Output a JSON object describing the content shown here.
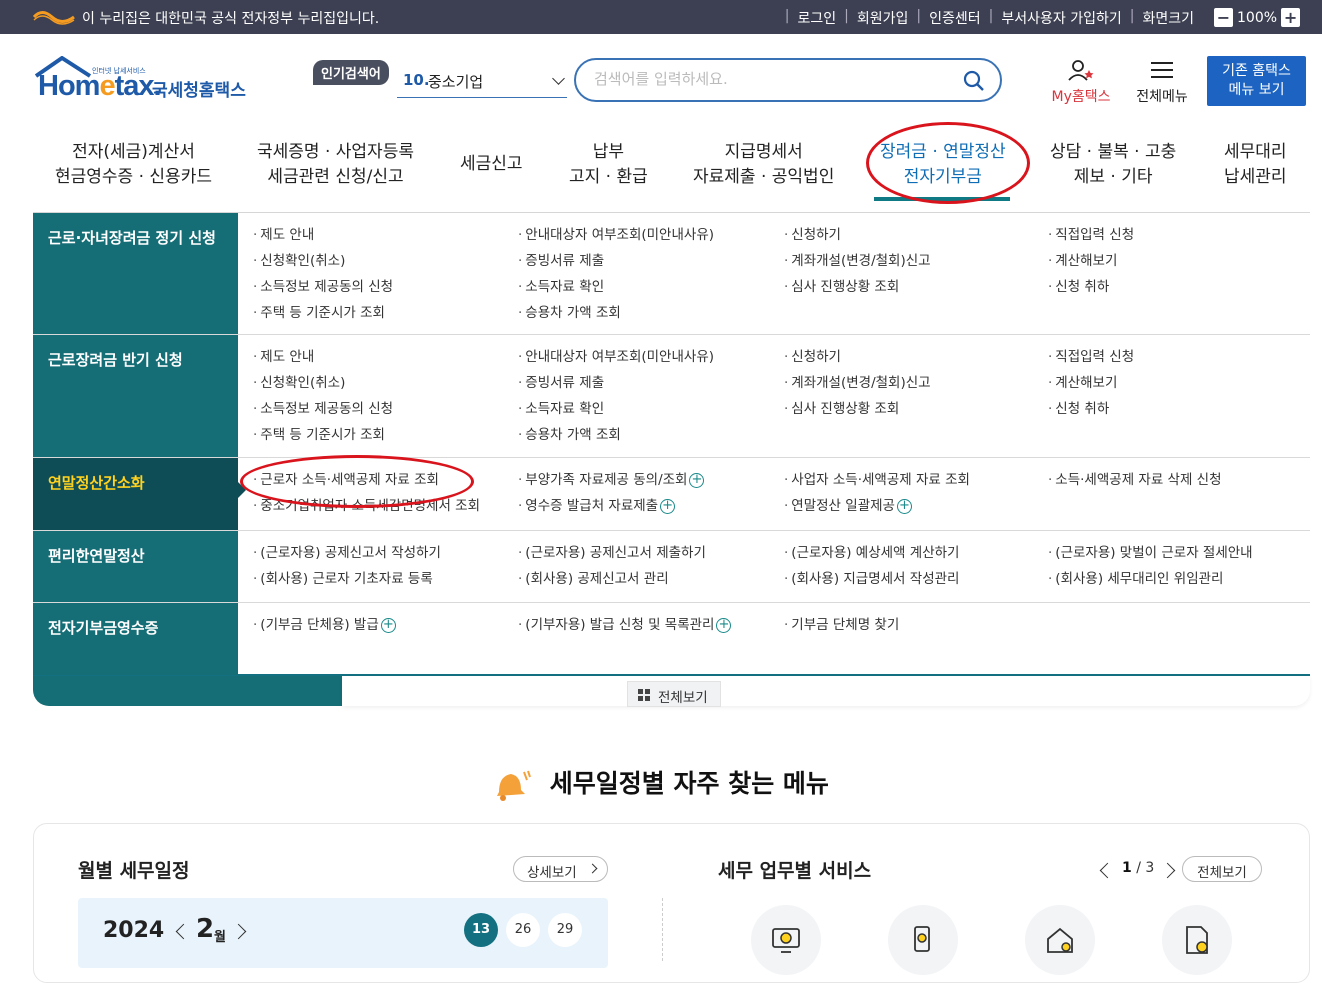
{
  "topbar": {
    "gov_notice": "이 누리집은 대한민국 공식 전자정부 누리집입니다.",
    "links": [
      "로그인",
      "회원가입",
      "인증센터",
      "부서사용자 가입하기",
      "화면크기"
    ],
    "zoom": "100%"
  },
  "header": {
    "logo_small": "인터넷 납세서비스",
    "logo_word_a": "Hom",
    "logo_word_b": "e",
    "logo_word_c": "tax.",
    "logo_kr": "국세청홈택스",
    "popular_badge": "인기검색어",
    "popular_num": "10.",
    "popular_word": "중소기업",
    "search_placeholder": "검색어를 입력하세요.",
    "my_hometax": "My홈택스",
    "all_menu": "전체메뉴",
    "old_menu_1": "기존 홈택스",
    "old_menu_2": "메뉴 보기"
  },
  "gnb": [
    {
      "l1": "전자(세금)계산서",
      "l2": "현금영수증 · 신용카드"
    },
    {
      "l1": "국세증명 · 사업자등록",
      "l2": "세금관련 신청/신고"
    },
    {
      "l1": "세금신고",
      "l2": ""
    },
    {
      "l1": "납부",
      "l2": "고지 · 환급"
    },
    {
      "l1": "지급명세서",
      "l2": "자료제출 · 공익법인"
    },
    {
      "l1": "장려금 · 연말정산",
      "l2": "전자기부금"
    },
    {
      "l1": "상담 · 불복 · 고충",
      "l2": "제보 · 기타"
    },
    {
      "l1": "세무대리",
      "l2": "납세관리"
    }
  ],
  "menu": [
    {
      "label": "근로·자녀장려금 정기 신청",
      "cols": [
        [
          "제도 안내",
          "신청확인(취소)",
          "소득정보 제공동의 신청",
          "주택 등 기준시가 조회"
        ],
        [
          "안내대상자 여부조회(미안내사유)",
          "증빙서류 제출",
          "소득자료 확인",
          "승용차 가액 조회"
        ],
        [
          "신청하기",
          "계좌개설(변경/철회)신고",
          "심사 진행상황 조회"
        ],
        [
          "직접입력 신청",
          "계산해보기",
          "신청 취하"
        ]
      ]
    },
    {
      "label": "근로장려금 반기 신청",
      "cols": [
        [
          "제도 안내",
          "신청확인(취소)",
          "소득정보 제공동의 신청",
          "주택 등 기준시가 조회"
        ],
        [
          "안내대상자 여부조회(미안내사유)",
          "증빙서류 제출",
          "소득자료 확인",
          "승용차 가액 조회"
        ],
        [
          "신청하기",
          "계좌개설(변경/철회)신고",
          "심사 진행상황 조회"
        ],
        [
          "직접입력 신청",
          "계산해보기",
          "신청 취하"
        ]
      ]
    },
    {
      "label": "연말정산간소화",
      "cols": [
        [
          "근로자 소득·세액공제 자료 조회",
          "중소기업취업자 소득세감면명세서 조회"
        ],
        [
          "부양가족 자료제공 동의/조회",
          "영수증 발급처 자료제출"
        ],
        [
          "사업자 소득·세액공제 자료 조회",
          "연말정산 일괄제공"
        ],
        [
          "소득·세액공제 자료 삭제 신청"
        ]
      ]
    },
    {
      "label": "편리한연말정산",
      "cols": [
        [
          "(근로자용) 공제신고서 작성하기",
          "(회사용) 근로자 기초자료 등록"
        ],
        [
          "(근로자용) 공제신고서 제출하기",
          "(회사용) 공제신고서 관리"
        ],
        [
          "(근로자용) 예상세액 계산하기",
          "(회사용) 지급명세서 작성관리"
        ],
        [
          "(근로자용) 맞벌이 근로자 절세안내",
          "(회사용) 세무대리인 위임관리"
        ]
      ]
    },
    {
      "label": "전자기부금영수증",
      "cols": [
        [
          "(기부금 단체용) 발급"
        ],
        [
          "(기부자용) 발급 신청 및 목록관리"
        ],
        [
          "기부금 단체명 찾기"
        ]
      ]
    }
  ],
  "view_all": "전체보기",
  "section_title": "세무일정별 자주 찾는 메뉴",
  "monthly": {
    "title": "월별 세무일정",
    "detail": "상세보기",
    "year": "2024",
    "month": "2",
    "month_unit": "월",
    "days": [
      "13",
      "26",
      "29"
    ]
  },
  "services": {
    "title": "세무 업무별 서비스",
    "page_current": "1",
    "page_total": "3",
    "view_all": "전체보기"
  },
  "colors": {
    "topbar": "#3d4052",
    "teal": "#156d76",
    "brand_blue": "#1e5aa8",
    "annotation_red": "#d9141c"
  }
}
